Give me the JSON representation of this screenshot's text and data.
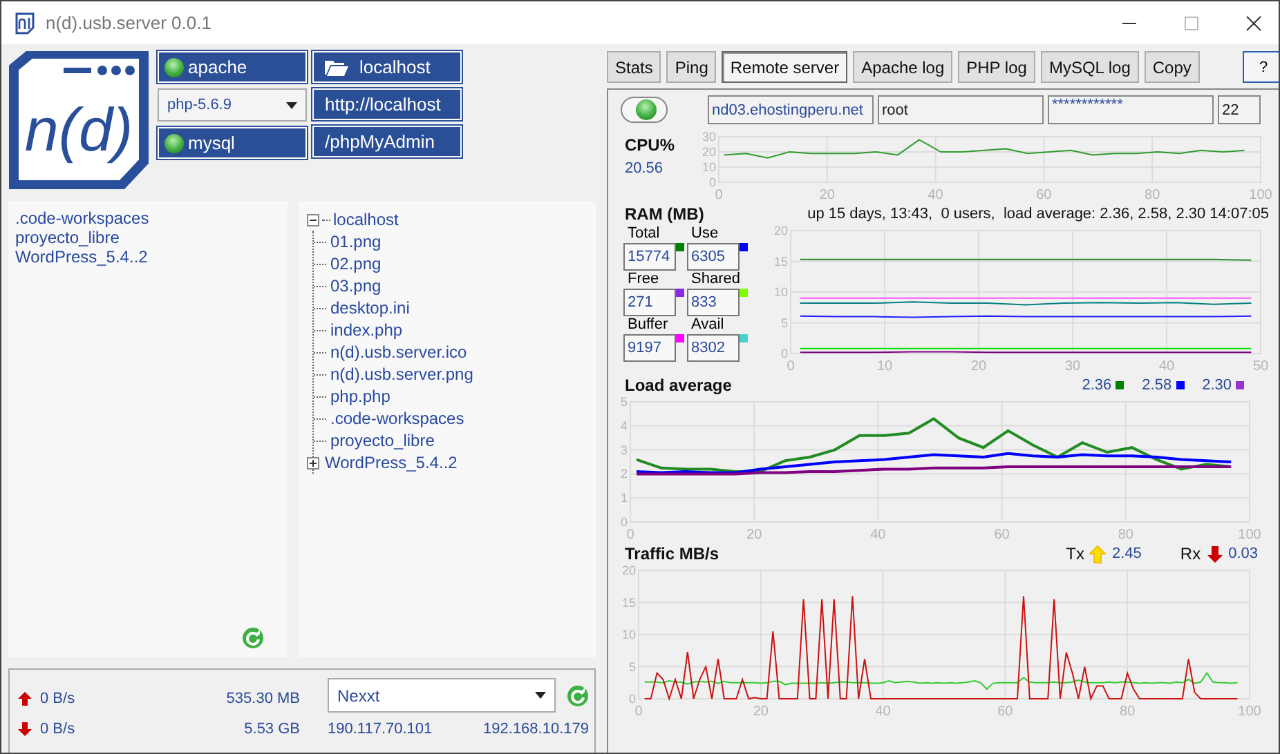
{
  "window": {
    "title": "n(d).usb.server 0.0.1"
  },
  "logo": {
    "text": "n(d)"
  },
  "services": [
    {
      "label": "apache",
      "running": true
    },
    {
      "label": "mysql",
      "running": true
    }
  ],
  "php_version": {
    "value": "php-5.6.9"
  },
  "links": [
    {
      "kind": "folder",
      "label": "localhost"
    },
    {
      "kind": "plain",
      "label": "http://localhost"
    },
    {
      "kind": "plain",
      "label": "/phpMyAdmin"
    }
  ],
  "projects": [
    ".code-workspaces",
    "proyecto_libre",
    "WordPress_5.4..2"
  ],
  "tree": {
    "label": "localhost",
    "expanded": true,
    "children": [
      {
        "label": "01.png"
      },
      {
        "label": "02.png"
      },
      {
        "label": "03.png"
      },
      {
        "label": "desktop.ini"
      },
      {
        "label": "index.php"
      },
      {
        "label": "n(d).usb.server.ico"
      },
      {
        "label": "n(d).usb.server.png"
      },
      {
        "label": "php.php"
      },
      {
        "label": ".code-workspaces"
      },
      {
        "label": "proyecto_libre"
      },
      {
        "label": "WordPress_5.4..2",
        "expanded": false
      }
    ]
  },
  "network": {
    "upload": "0 B/s",
    "download": "0 B/s",
    "sent": "535.30 MB",
    "received": "5.53 GB",
    "adapter": "Nexxt",
    "public_ip": "190.117.70.101",
    "local_ip": "192.168.10.179"
  },
  "tabs": [
    {
      "label": "Stats",
      "selected": false
    },
    {
      "label": "Ping",
      "selected": false
    },
    {
      "label": "Remote server",
      "selected": true
    },
    {
      "label": "Apache log",
      "selected": false
    },
    {
      "label": "PHP log",
      "selected": false
    },
    {
      "label": "MySQL log",
      "selected": false
    },
    {
      "label": "Copy",
      "selected": false
    }
  ],
  "help_button": "?",
  "remote": {
    "connected": true,
    "host": "nd03.ehostingperu.net",
    "user": "root",
    "password": "************",
    "port": "22"
  },
  "cpu": {
    "title": "CPU%",
    "value": "20.56",
    "chart_data": {
      "type": "line",
      "x": [
        1,
        5,
        9,
        13,
        17,
        21,
        25,
        29,
        33,
        37,
        41,
        45,
        49,
        53,
        57,
        61,
        65,
        69,
        73,
        77,
        81,
        85,
        89,
        93,
        97
      ],
      "series": [
        {
          "color": "#2e9b2e",
          "values": [
            18,
            19,
            16,
            20,
            19,
            19,
            19,
            20,
            18,
            28,
            20,
            20,
            21,
            22,
            19,
            20,
            21,
            18,
            19,
            19,
            20,
            19,
            21,
            20,
            21
          ]
        }
      ],
      "grid": true,
      "xlim": [
        0,
        100
      ],
      "ylim": [
        0,
        30
      ],
      "xticks": [
        0,
        20,
        40,
        60,
        80,
        100
      ],
      "yticks": [
        0,
        10,
        20,
        30
      ]
    }
  },
  "ram": {
    "title": "RAM (MB)",
    "uptime": "up 15 days, 13:43,  0 users,  load average: 2.36, 2.58, 2.30 14:07:05",
    "fields": [
      {
        "label": "Total",
        "value": "15774",
        "color": "#008000"
      },
      {
        "label": "Use",
        "value": "6305",
        "color": "#0000ff"
      },
      {
        "label": "Free",
        "value": "271",
        "color": "#8a2be2"
      },
      {
        "label": "Shared",
        "value": "833",
        "color": "#7fff00"
      },
      {
        "label": "Buffer",
        "value": "9197",
        "color": "#ff00ff"
      },
      {
        "label": "Avail",
        "value": "8302",
        "color": "#48d1cc"
      }
    ],
    "chart_data": {
      "type": "line",
      "x": [
        1,
        5,
        9,
        13,
        17,
        21,
        25,
        29,
        33,
        37,
        41,
        45,
        49
      ],
      "series": [
        {
          "color": "#2e8b2e",
          "values": [
            15.3,
            15.3,
            15.3,
            15.3,
            15.3,
            15.3,
            15.3,
            15.3,
            15.3,
            15.3,
            15.3,
            15.3,
            15.2
          ]
        },
        {
          "color": "#ff55ff",
          "values": [
            9,
            9,
            9,
            9,
            9,
            9,
            9,
            9,
            9,
            9,
            9,
            9,
            9
          ]
        },
        {
          "color": "#008080",
          "values": [
            8.2,
            8.2,
            8.2,
            8.4,
            8.2,
            8.2,
            7.9,
            8.2,
            8.3,
            8.2,
            8.3,
            8.0,
            8.2
          ]
        },
        {
          "color": "#2020ff",
          "values": [
            6.1,
            6.0,
            6.0,
            5.9,
            6.0,
            6.1,
            6.0,
            6.0,
            6.0,
            6.0,
            6.0,
            6.0,
            6.1
          ]
        },
        {
          "color": "#00e000",
          "values": [
            0.8,
            0.8,
            0.8,
            0.8,
            0.8,
            0.8,
            0.8,
            0.8,
            0.8,
            0.8,
            0.8,
            0.8,
            0.8
          ]
        },
        {
          "color": "#800080",
          "values": [
            0.2,
            0.2,
            0.2,
            0.3,
            0.3,
            0.2,
            0.2,
            0.2,
            0.2,
            0.2,
            0.2,
            0.2,
            0.2
          ]
        }
      ],
      "grid": true,
      "xlim": [
        0,
        50
      ],
      "ylim": [
        0,
        20
      ],
      "xticks": [
        0,
        10,
        20,
        30,
        40,
        50
      ],
      "yticks": [
        0,
        5,
        10,
        15,
        20
      ]
    }
  },
  "load_average": {
    "title": "Load average",
    "legend": [
      {
        "value": "2.36",
        "color": "#008000"
      },
      {
        "value": "2.58",
        "color": "#0000ff"
      },
      {
        "value": "2.30",
        "color": "#9933cc"
      }
    ],
    "chart_data": {
      "type": "line",
      "x": [
        1,
        5,
        9,
        13,
        17,
        21,
        25,
        29,
        33,
        37,
        41,
        45,
        49,
        53,
        57,
        61,
        65,
        69,
        73,
        77,
        81,
        85,
        89,
        93,
        97
      ],
      "series": [
        {
          "color": "#228b22",
          "values": [
            2.6,
            2.25,
            2.2,
            2.2,
            2.1,
            2.1,
            2.55,
            2.7,
            3.0,
            3.6,
            3.6,
            3.7,
            4.3,
            3.5,
            3.1,
            3.8,
            3.2,
            2.7,
            3.3,
            2.9,
            3.1,
            2.6,
            2.2,
            2.4,
            2.3
          ]
        },
        {
          "color": "#0000ff",
          "values": [
            2.1,
            2.05,
            2.1,
            2.05,
            2.05,
            2.2,
            2.3,
            2.4,
            2.5,
            2.55,
            2.6,
            2.7,
            2.8,
            2.75,
            2.7,
            2.85,
            2.75,
            2.7,
            2.8,
            2.75,
            2.75,
            2.7,
            2.6,
            2.55,
            2.5
          ]
        },
        {
          "color": "#800080",
          "values": [
            2.0,
            2.0,
            2.0,
            2.0,
            2.0,
            2.05,
            2.05,
            2.1,
            2.1,
            2.15,
            2.2,
            2.2,
            2.25,
            2.25,
            2.25,
            2.3,
            2.3,
            2.3,
            2.3,
            2.3,
            2.3,
            2.3,
            2.3,
            2.3,
            2.3
          ]
        }
      ],
      "grid": true,
      "xlim": [
        0,
        100
      ],
      "ylim": [
        0,
        5
      ],
      "xticks": [
        0,
        20,
        40,
        60,
        80,
        100
      ],
      "yticks": [
        0,
        1,
        2,
        3,
        4,
        5
      ]
    }
  },
  "traffic": {
    "title": "Traffic MB/s",
    "tx": {
      "label": "Tx",
      "value": "2.45"
    },
    "rx": {
      "label": "Rx",
      "value": "0.03"
    },
    "chart_data": {
      "type": "line",
      "x": [
        1,
        2,
        3,
        4,
        5,
        6,
        7,
        8,
        9,
        10,
        11,
        12,
        13,
        14,
        15,
        16,
        17,
        18,
        19,
        20,
        21,
        22,
        23,
        24,
        25,
        26,
        27,
        28,
        29,
        30,
        31,
        32,
        33,
        34,
        35,
        36,
        37,
        38,
        39,
        40,
        41,
        42,
        43,
        44,
        45,
        46,
        47,
        48,
        49,
        50,
        51,
        52,
        53,
        54,
        55,
        56,
        57,
        58,
        59,
        60,
        61,
        62,
        63,
        64,
        65,
        66,
        67,
        68,
        69,
        70,
        71,
        72,
        73,
        74,
        75,
        76,
        77,
        78,
        79,
        80,
        81,
        82,
        83,
        84,
        85,
        86,
        87,
        88,
        89,
        90,
        91,
        92,
        93,
        94,
        95,
        96,
        97,
        98
      ],
      "series": [
        {
          "color": "#33cc33",
          "values": [
            2.6,
            2.6,
            2.6,
            2.5,
            2.8,
            2.6,
            2.6,
            2.3,
            2.6,
            2.7,
            2.6,
            2.7,
            2.4,
            2.7,
            2.5,
            2.5,
            2.5,
            2.5,
            2.5,
            2.4,
            2.5,
            2.7,
            2.7,
            2.2,
            2.4,
            2.4,
            2.4,
            2.4,
            2.4,
            2.5,
            2.4,
            2.5,
            2.6,
            2.6,
            2.5,
            2.5,
            2.5,
            2.4,
            2.4,
            2.5,
            2.8,
            2.5,
            2.6,
            2.7,
            2.6,
            2.4,
            2.5,
            2.4,
            2.5,
            2.4,
            2.5,
            2.4,
            2.5,
            2.6,
            2.8,
            2.5,
            1.5,
            2.4,
            2.5,
            2.5,
            2.5,
            2.5,
            3.3,
            2.6,
            2.5,
            2.5,
            2.5,
            2.6,
            2.5,
            2.5,
            2.6,
            2.9,
            2.6,
            2.5,
            2.5,
            2.5,
            2.6,
            2.5,
            2.6,
            2.6,
            2.5,
            2.4,
            2.5,
            2.4,
            2.5,
            2.5,
            2.4,
            2.6,
            2.5,
            3.0,
            2.4,
            2.6,
            4.0,
            2.6,
            2.5,
            2.5,
            2.4,
            2.5
          ]
        },
        {
          "color": "#cc1111",
          "values": [
            0,
            0,
            4,
            3,
            0,
            3,
            0,
            7.3,
            0,
            3,
            5,
            0,
            6.2,
            0,
            0,
            0,
            3,
            0,
            0.2,
            0,
            0,
            10.5,
            0,
            0,
            0,
            0,
            15.5,
            0,
            0,
            15.5,
            0,
            15.5,
            0,
            0,
            16,
            0,
            6.2,
            0,
            0,
            0,
            0,
            0,
            0,
            0,
            0,
            0,
            0,
            0,
            0,
            0,
            0,
            0,
            0,
            0,
            0,
            0,
            0,
            0,
            0,
            0,
            0,
            0,
            16,
            0,
            0,
            0,
            0,
            15.5,
            0,
            7.2,
            4,
            0,
            5,
            0,
            2,
            2,
            0,
            0,
            0,
            4,
            1.5,
            0,
            0,
            0,
            0,
            0,
            0,
            0,
            0,
            6.2,
            1,
            0,
            0,
            0,
            0,
            0,
            0,
            0
          ]
        }
      ],
      "grid": true,
      "xlim": [
        0,
        100
      ],
      "ylim": [
        0,
        20
      ],
      "xticks": [
        0,
        20,
        40,
        60,
        80,
        100
      ],
      "yticks": [
        0,
        5,
        10,
        15,
        20
      ]
    }
  }
}
